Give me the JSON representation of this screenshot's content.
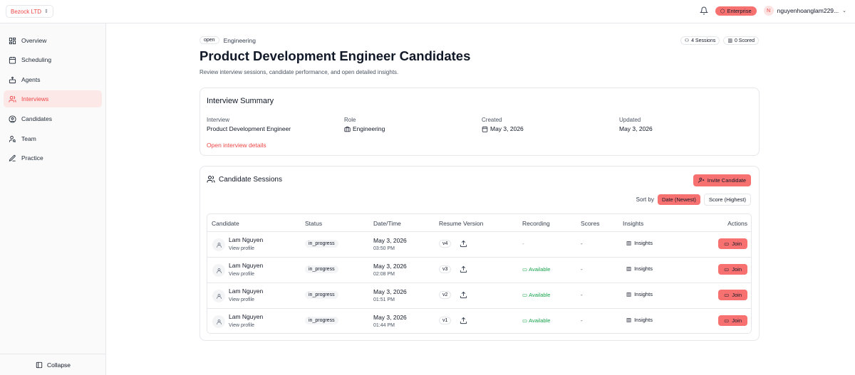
{
  "topbar": {
    "org": "Bezock LTD",
    "plan": "Enterprise",
    "user_initial": "N",
    "user_name": "nguyenhoanglam229..."
  },
  "sidebar": {
    "items": [
      {
        "label": "Overview",
        "icon": "grid-icon"
      },
      {
        "label": "Scheduling",
        "icon": "calendar-icon"
      },
      {
        "label": "Agents",
        "icon": "robot-icon"
      },
      {
        "label": "Interviews",
        "icon": "users-icon",
        "active": true
      },
      {
        "label": "Candidates",
        "icon": "user-circle-icon"
      },
      {
        "label": "Team",
        "icon": "user-search-icon"
      },
      {
        "label": "Practice",
        "icon": "pen-icon"
      }
    ],
    "collapse_label": "Collapse"
  },
  "header": {
    "status_pill": "open",
    "department": "Engineering",
    "sessions": "4 Sessions",
    "scored": "0 Scored",
    "title": "Product Development Engineer Candidates",
    "description": "Review interview sessions, candidate performance, and open detailed insights."
  },
  "summary": {
    "title": "Interview Summary",
    "interview_label": "Interview",
    "interview_value": "Product Development Engineer",
    "role_label": "Role",
    "role_value": "Engineering",
    "created_label": "Created",
    "created_value": "May 3, 2026",
    "updated_label": "Updated",
    "updated_value": "May 3, 2026",
    "link": "Open interview details"
  },
  "sessions": {
    "title": "Candidate Sessions",
    "invite_label": "Invite Candidate",
    "sort_label": "Sort by",
    "sort_active": "Date (Newest)",
    "sort_other": "Score (Highest)",
    "columns": {
      "candidate": "Candidate",
      "status": "Status",
      "datetime": "Date/Time",
      "resume": "Resume Version",
      "recording": "Recording",
      "scores": "Scores",
      "insights": "Insights",
      "actions": "Actions"
    },
    "rows": [
      {
        "name": "Lam Nguyen",
        "link": "View profile",
        "status": "in_progress",
        "date": "May 3, 2026",
        "time": "03:50 PM",
        "version": "v4",
        "recording": "-",
        "score": "-",
        "insights": "Insights",
        "action": "Join"
      },
      {
        "name": "Lam Nguyen",
        "link": "View profile",
        "status": "in_progress",
        "date": "May 3, 2026",
        "time": "02:08 PM",
        "version": "v3",
        "recording": "Available",
        "score": "-",
        "insights": "Insights",
        "action": "Join"
      },
      {
        "name": "Lam Nguyen",
        "link": "View profile",
        "status": "in_progress",
        "date": "May 3, 2026",
        "time": "01:51 PM",
        "version": "v2",
        "recording": "Available",
        "score": "-",
        "insights": "Insights",
        "action": "Join"
      },
      {
        "name": "Lam Nguyen",
        "link": "View profile",
        "status": "in_progress",
        "date": "May 3, 2026",
        "time": "01:44 PM",
        "version": "v1",
        "recording": "Available",
        "score": "-",
        "insights": "Insights",
        "action": "Join"
      }
    ]
  },
  "colors": {
    "accent": "#f87171",
    "accent_text": "#ef4444",
    "available": "#16a34a"
  }
}
